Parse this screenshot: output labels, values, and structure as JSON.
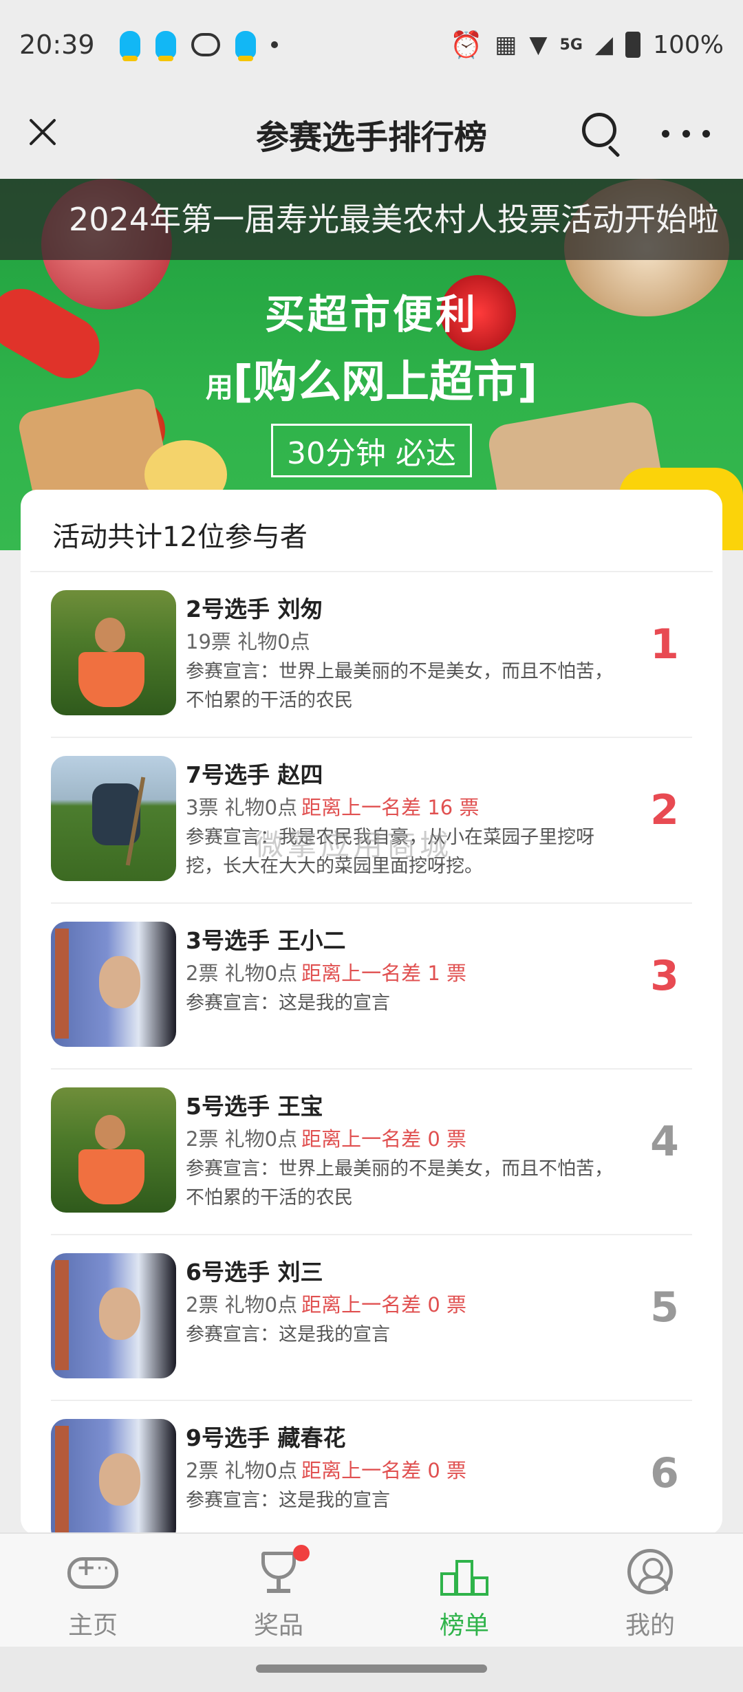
{
  "status_bar": {
    "time": "20:39",
    "network": "5G",
    "battery": "100%",
    "icons": [
      "qq-icon",
      "qq-icon",
      "wechat-icon",
      "qq-icon",
      "dot-icon",
      "alarm-icon",
      "nfc-icon",
      "wifi-icon",
      "signal-icon",
      "battery-icon"
    ]
  },
  "header": {
    "title": "参赛选手排行榜"
  },
  "banner": {
    "marquee": "2024年第一届寿光最美农村人投票活动开始啦",
    "line1": "买超市便利",
    "line2_prefix": "用",
    "line2_main": "[购么网上超市]",
    "badge": "30分钟 必达"
  },
  "list": {
    "summary": "活动共计12位参与者",
    "watermark": "微擎应用商城",
    "entries": [
      {
        "name": "2号选手 刘匆",
        "stats": "19票 礼物0点",
        "gap": "",
        "declaration": "参赛宣言：世界上最美丽的不是美女，而且不怕苦，不怕累的干活的农民",
        "rank": "1"
      },
      {
        "name": "7号选手 赵四",
        "stats": "3票 礼物0点",
        "gap": "距离上一名差 16 票",
        "declaration": "参赛宣言：我是农民我自豪，从小在菜园子里挖呀挖，长大在大大的菜园里面挖呀挖。",
        "rank": "2"
      },
      {
        "name": "3号选手 王小二",
        "stats": "2票 礼物0点",
        "gap": "距离上一名差 1 票",
        "declaration": "参赛宣言：这是我的宣言",
        "rank": "3"
      },
      {
        "name": "5号选手 王宝",
        "stats": "2票 礼物0点",
        "gap": "距离上一名差 0 票",
        "declaration": "参赛宣言：世界上最美丽的不是美女，而且不怕苦，不怕累的干活的农民",
        "rank": "4"
      },
      {
        "name": "6号选手 刘三",
        "stats": "2票 礼物0点",
        "gap": "距离上一名差 0 票",
        "declaration": "参赛宣言：这是我的宣言",
        "rank": "5"
      },
      {
        "name": "9号选手 藏春花",
        "stats": "2票 礼物0点",
        "gap": "距离上一名差 0 票",
        "declaration": "参赛宣言：这是我的宣言",
        "rank": "6"
      }
    ]
  },
  "tabs": [
    {
      "label": "主页",
      "icon": "gamepad-icon"
    },
    {
      "label": "奖品",
      "icon": "trophy-icon"
    },
    {
      "label": "榜单",
      "icon": "podium-icon"
    },
    {
      "label": "我的",
      "icon": "profile-icon"
    }
  ],
  "colors": {
    "accent": "#2fb34a",
    "rank_top": "#e84a52",
    "gap_text": "#e05050"
  }
}
